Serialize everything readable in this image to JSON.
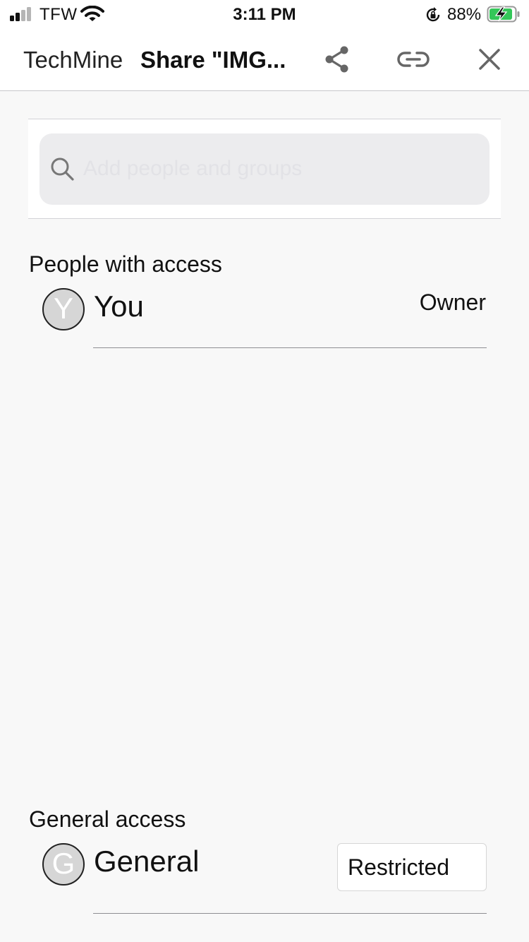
{
  "status_bar": {
    "carrier": "TFW",
    "time": "3:11 PM",
    "battery_percent": "88%",
    "signal_bars": 2,
    "icons": [
      "signal-icon",
      "wifi-icon",
      "rotation-lock-icon",
      "battery-charging-icon"
    ],
    "battery_color": "#34c759"
  },
  "nav": {
    "app_name": "TechMine",
    "title": "Share \"IMG...",
    "icons": [
      "share-icon",
      "link-icon",
      "close-icon"
    ]
  },
  "search": {
    "placeholder": "Add people and groups",
    "value": ""
  },
  "people_section": {
    "heading": "People with access",
    "people": [
      {
        "initial": "Y",
        "name": "You",
        "role": "Owner"
      }
    ]
  },
  "general_section": {
    "heading": "General access",
    "initial": "G",
    "name": "General",
    "access_level": "Restricted"
  },
  "colors": {
    "background": "#f8f8f8",
    "search_fill": "#ececee",
    "avatar_fill": "#d6d6d6"
  }
}
